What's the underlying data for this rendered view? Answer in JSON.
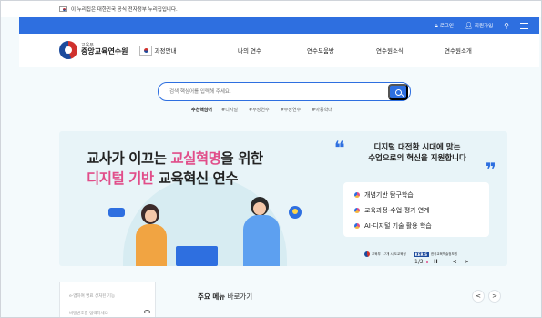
{
  "gov_strip": {
    "text": "이 누리집은 대한민국 공식 전자정부 누리집입니다."
  },
  "util_bar": {
    "login": "로그인",
    "signup": "회원가입",
    "login_icon": "lock-icon",
    "signup_icon": "user-icon"
  },
  "header": {
    "logo_sub": "교육부",
    "logo_name": "중앙교육연수원",
    "course_label": "과정안내",
    "nav": [
      "나의 연수",
      "연수도움방",
      "연수원소식",
      "연수원소개"
    ]
  },
  "search": {
    "placeholder": "검색 핵심어를 입력해 주세요.",
    "keywords_title": "추천핵심어",
    "keywords": [
      "#디지털",
      "#부장연수",
      "#부장연수",
      "#아동학대"
    ]
  },
  "banner": {
    "title_line1_pre": "교사가 이끄는 ",
    "title_line1_hl": "교실혁명",
    "title_line1_post": "을 위한",
    "title_line2_hl": "디지털 기반",
    "title_line2_post": " 교육혁신 연수",
    "quote_open": "❝",
    "quote_close": "❞",
    "sub_line1": "디지털 대전환 시대에 맞는",
    "sub_line2": "수업으로의 혁신을 지원합니다",
    "items": [
      "개념기반 탐구학습",
      "교육과정-수업-평가 연계",
      "AI·디지털 기술 활용 학습"
    ],
    "logo_moe": "교육부",
    "logo_edu_office": "17개 시·도교육청",
    "logo_keris": "KERIS",
    "logo_keris_full": "한국교육학술정보원",
    "pager": "1/2",
    "pause": "II"
  },
  "lower": {
    "field1": "e-앱하여 명료 상처된 기능",
    "field2": "비밀번호를 입력하세요",
    "quick_bold": "주요 메뉴",
    "quick_rest": " 바로가기",
    "prev": "<",
    "next": ">"
  },
  "colors": {
    "primary_blue": "#2e6fe0",
    "accent_pink": "#e14d89",
    "banner_bg": "#e8f4f8"
  }
}
